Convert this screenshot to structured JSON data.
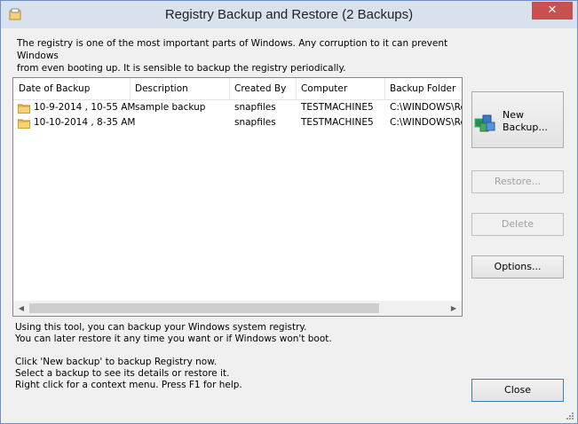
{
  "window": {
    "title": "Registry Backup and Restore  (2 Backups)",
    "close_glyph": "✕"
  },
  "intro": {
    "line1": "The registry is one of the most important parts of Windows. Any corruption to it can prevent Windows",
    "line2": "from even booting up.  It is sensible to backup the registry periodically."
  },
  "table": {
    "columns": [
      "Date of Backup",
      "Description",
      "Created By",
      "Computer",
      "Backup Folder"
    ],
    "rows": [
      [
        "10-9-2014 , 10-55 AM",
        "sample backup",
        "snapfiles",
        "TESTMACHINE5",
        "C:\\WINDOWS\\Re"
      ],
      [
        "10-10-2014 , 8-35 AM",
        "",
        "snapfiles",
        "TESTMACHINE5",
        "C:\\WINDOWS\\Re"
      ]
    ]
  },
  "buttons": {
    "new_backup_line1": "New",
    "new_backup_line2": "Backup...",
    "restore": "Restore...",
    "delete": "Delete",
    "options": "Options...",
    "close": "Close"
  },
  "footer": {
    "line1": "Using this tool, you can backup your Windows system registry.",
    "line2": "You can later restore it any time you want or if Windows won't boot.",
    "line3": "Click 'New backup' to backup Registry now.",
    "line4": "Select a backup to see its details or restore it.",
    "line5": "Right click for a context menu. Press F1 for help."
  },
  "icons": {
    "app": "registry-app-icon",
    "folder": "folder-icon",
    "new_backup": "registry-cubes-icon"
  },
  "colors": {
    "titlebar": "#d8e1ee",
    "close_button": "#c75050",
    "list_background": "#ffffff",
    "disabled_text": "#a0a0a0"
  }
}
